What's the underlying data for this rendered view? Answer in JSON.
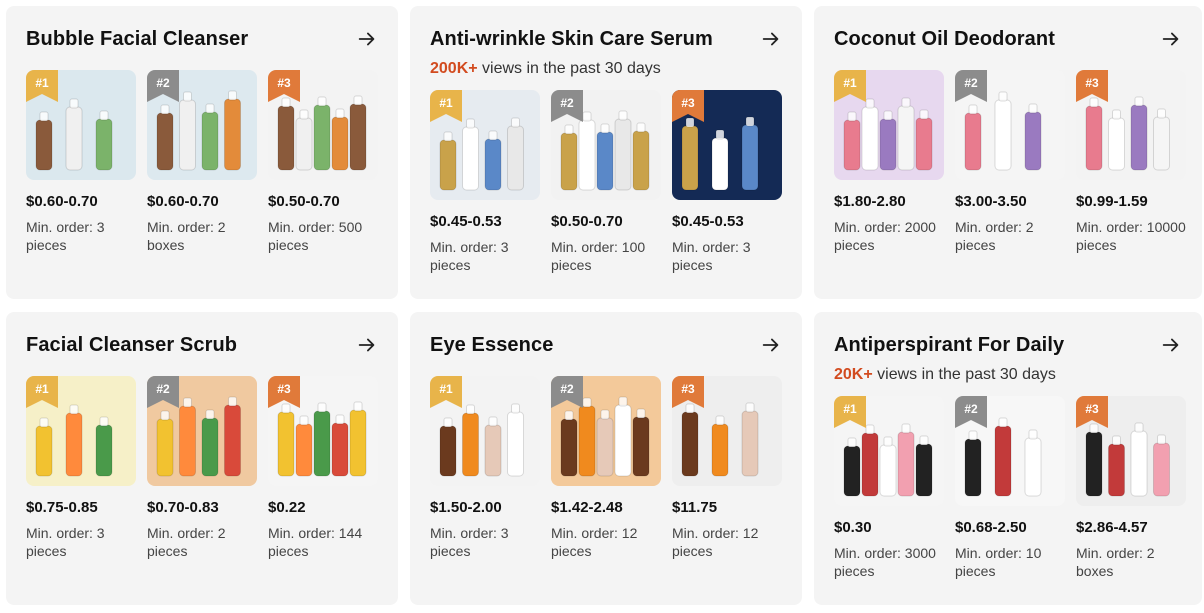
{
  "cards": [
    {
      "title": "Bubble Facial Cleanser",
      "views": null,
      "products": [
        {
          "rank": "#1",
          "price": "$0.60-0.70",
          "moq": "Min. order: 3 pieces",
          "bg": "#dbe8ee"
        },
        {
          "rank": "#2",
          "price": "$0.60-0.70",
          "moq": "Min. order: 2 boxes",
          "bg": "#dde9ef"
        },
        {
          "rank": "#3",
          "price": "$0.50-0.70",
          "moq": "Min. order: 500 pieces",
          "bg": "#f3f3f3"
        }
      ]
    },
    {
      "title": "Anti-wrinkle Skin Care Serum",
      "views": {
        "count": "200K+",
        "text": " views in the past 30 days"
      },
      "products": [
        {
          "rank": "#1",
          "price": "$0.45-0.53",
          "moq": "Min. order: 3 pieces",
          "bg": "#e6ebf0"
        },
        {
          "rank": "#2",
          "price": "$0.50-0.70",
          "moq": "Min. order: 100 pieces",
          "bg": "#f2f2f2"
        },
        {
          "rank": "#3",
          "price": "$0.45-0.53",
          "moq": "Min. order: 3 pieces",
          "bg": "#142a55"
        }
      ]
    },
    {
      "title": "Coconut Oil Deodorant",
      "views": null,
      "products": [
        {
          "rank": "#1",
          "price": "$1.80-2.80",
          "moq": "Min. order: 2000 pieces",
          "bg": "#e7d8ef"
        },
        {
          "rank": "#2",
          "price": "$3.00-3.50",
          "moq": "Min. order: 2 pieces",
          "bg": "#f5f5f5"
        },
        {
          "rank": "#3",
          "price": "$0.99-1.59",
          "moq": "Min. order: 10000 pieces",
          "bg": "#f3f3f3"
        }
      ]
    },
    {
      "title": "Facial Cleanser Scrub",
      "views": null,
      "products": [
        {
          "rank": "#1",
          "price": "$0.75-0.85",
          "moq": "Min. order: 3 pieces",
          "bg": "#f6f0c8"
        },
        {
          "rank": "#2",
          "price": "$0.70-0.83",
          "moq": "Min. order: 2 pieces",
          "bg": "#f0c9a0"
        },
        {
          "rank": "#3",
          "price": "$0.22",
          "moq": "Min. order: 144 pieces",
          "bg": "#f5f5f5"
        }
      ]
    },
    {
      "title": "Eye Essence",
      "views": null,
      "products": [
        {
          "rank": "#1",
          "price": "$1.50-2.00",
          "moq": "Min. order: 3 pieces",
          "bg": "#f3f3f3"
        },
        {
          "rank": "#2",
          "price": "$1.42-2.48",
          "moq": "Min. order: 12 pieces",
          "bg": "#f3c99a"
        },
        {
          "rank": "#3",
          "price": "$11.75",
          "moq": "Min. order: 12 pieces",
          "bg": "#eeeeee"
        }
      ]
    },
    {
      "title": "Antiperspirant For Daily",
      "views": {
        "count": "20K+",
        "text": " views in the past 30 days"
      },
      "products": [
        {
          "rank": "#1",
          "price": "$0.30",
          "moq": "Min. order: 3000 pieces",
          "bg": "#f5f5f5"
        },
        {
          "rank": "#2",
          "price": "$0.68-2.50",
          "moq": "Min. order: 10 pieces",
          "bg": "#f7f7f7"
        },
        {
          "rank": "#3",
          "price": "$2.86-4.57",
          "moq": "Min. order: 2 boxes",
          "bg": "#eeeeee"
        }
      ]
    }
  ],
  "rank_colors": [
    "#e8b44a",
    "#8c8c8c",
    "#e07a3a"
  ],
  "accent": "#d24b1f",
  "arrow_icon": "arrow-right-icon"
}
